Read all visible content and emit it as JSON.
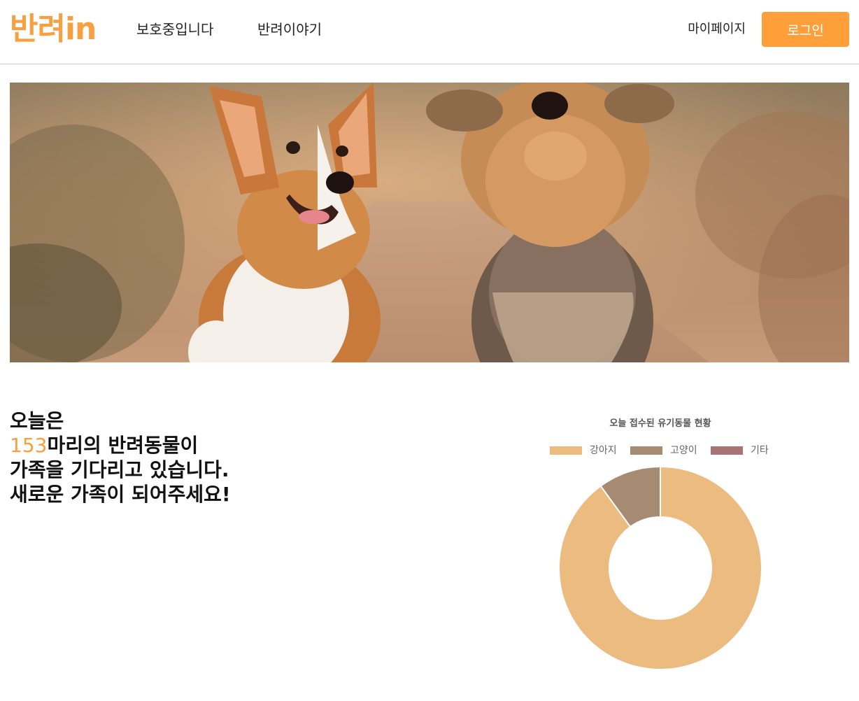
{
  "header": {
    "logo": "반려in",
    "nav": [
      {
        "label": "보호중입니다"
      },
      {
        "label": "반려이야기"
      }
    ],
    "mypage_label": "마이페이지",
    "login_label": "로그인"
  },
  "hero": {
    "image": "two dogs (corgi and yorkshire terrier) running on a dirt path at sunset"
  },
  "welcome": {
    "line1": "오늘은",
    "count": "153",
    "line2_rest": "마리의 반려동물이",
    "line3": "가족을 기다리고 있습니다.",
    "line4": "새로운 가족이 되어주세요!"
  },
  "colors": {
    "brand": "#f6a03f",
    "login_button": "#ff9f3a",
    "dog": "#ecbb80",
    "cat": "#a78a72",
    "other": "#a77474"
  },
  "chart_data": {
    "type": "doughnut",
    "title": "오늘 접수된 유기동물 현황",
    "categories": [
      "강아지",
      "고양이",
      "기타"
    ],
    "values": [
      90,
      10,
      0
    ],
    "colors": [
      "#ecbb80",
      "#a78a72",
      "#a77474"
    ],
    "legend_position": "top"
  }
}
